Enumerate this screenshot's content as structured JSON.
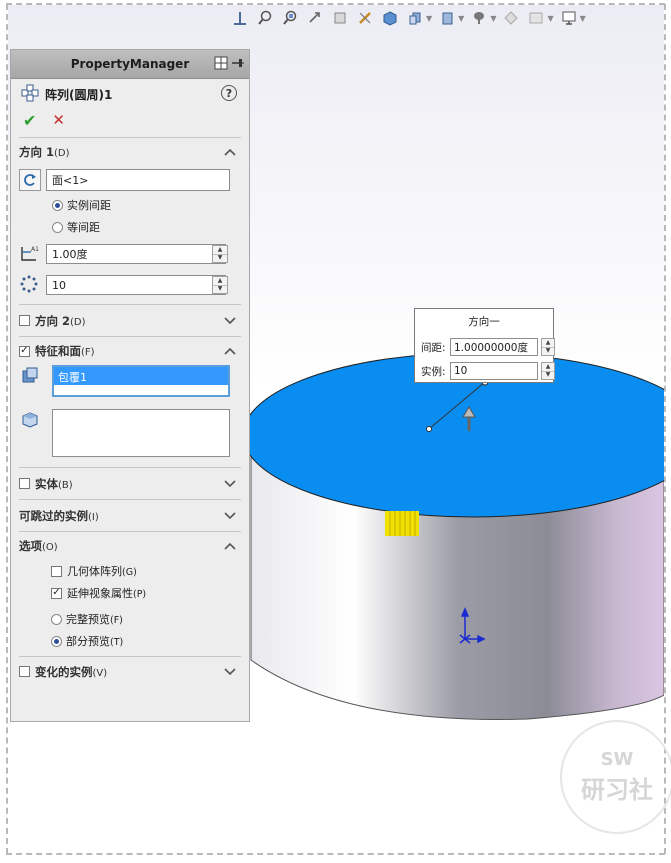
{
  "panel": {
    "header_title": "PropertyManager",
    "feature_title": "阵列(圆周)1",
    "help_label": "?"
  },
  "direction1": {
    "title": "方向 1",
    "key": "(D)",
    "face_value": "面<1>",
    "radio_instance_spacing": "实例间距",
    "radio_equal_spacing": "等间距",
    "angle_value": "1.00度",
    "count_value": "10"
  },
  "direction2": {
    "title": "方向 2",
    "key": "(D)"
  },
  "features": {
    "title": "特征和面",
    "key": "(F)",
    "selected_item": "包覆1"
  },
  "bodies": {
    "title": "实体",
    "key": "(B)"
  },
  "skip": {
    "title": "可跳过的实例",
    "key": "(I)"
  },
  "options": {
    "title": "选项",
    "key": "(O)",
    "geometry_pattern": "几何体阵列",
    "geometry_key": "(G)",
    "propagate_visual": "延伸视象属性",
    "propagate_key": "(P)",
    "full_preview": "完整预览",
    "full_key": "(F)",
    "partial_preview": "部分预览",
    "partial_key": "(T)"
  },
  "varied": {
    "title": "变化的实例",
    "key": "(V)"
  },
  "callout": {
    "title": "方向一",
    "spacing_label": "间距:",
    "spacing_value": "1.00000000度",
    "instances_label": "实例:",
    "instances_value": "10"
  },
  "watermark": {
    "line1": "SW",
    "line2": "研习社"
  },
  "colors": {
    "top_face": "#0a8df0",
    "decal": "#f0e200",
    "accent_blue": "#3399ff"
  }
}
